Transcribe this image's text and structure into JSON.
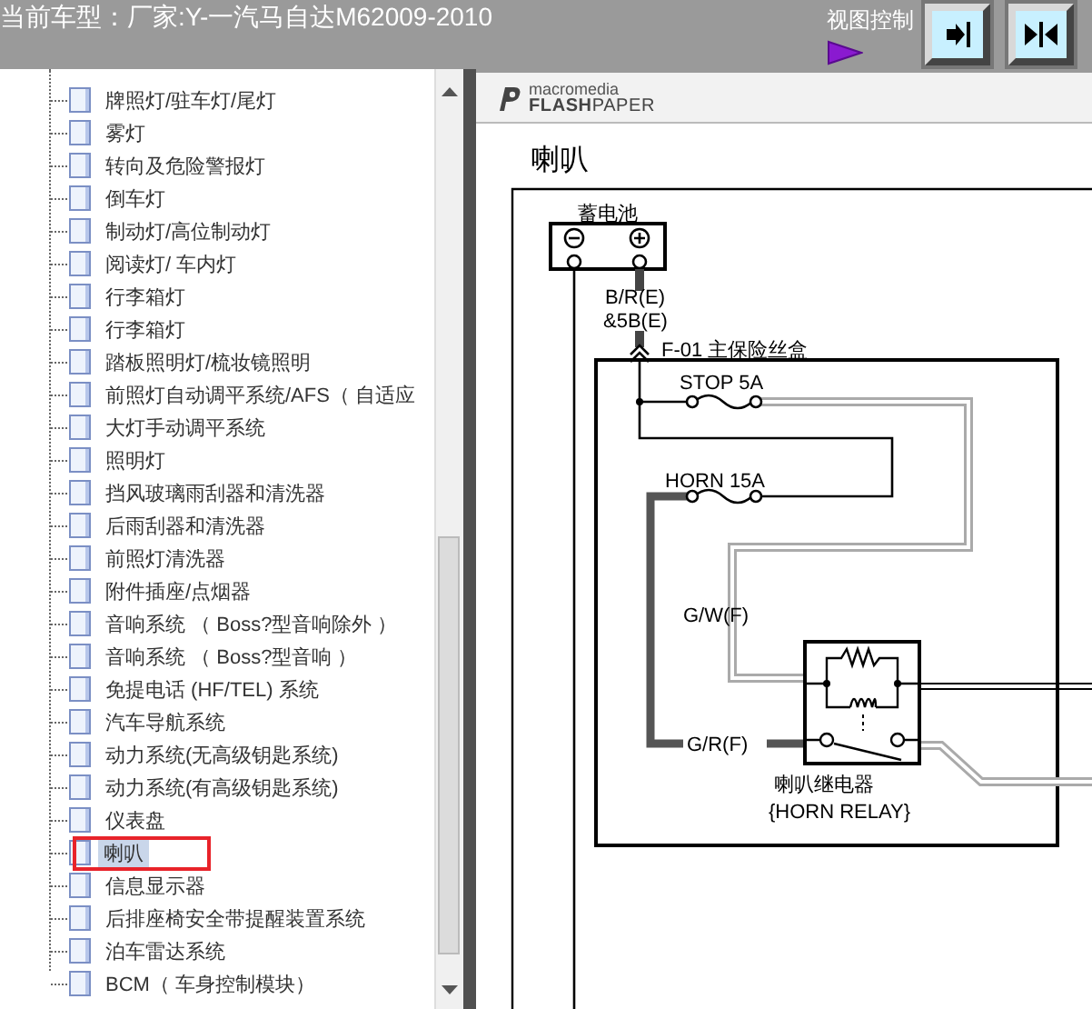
{
  "title_bar": {
    "text": "当前车型：厂家:Y-一汽马自达M62009-2010"
  },
  "view_control": {
    "label": "视图控制",
    "buttons": [
      {
        "kind": "expand"
      },
      {
        "kind": "split"
      }
    ]
  },
  "tree": {
    "items": [
      {
        "label": "牌照灯/驻车灯/尾灯",
        "selected": false
      },
      {
        "label": "雾灯",
        "selected": false
      },
      {
        "label": "转向及危险警报灯",
        "selected": false
      },
      {
        "label": "倒车灯",
        "selected": false
      },
      {
        "label": "制动灯/高位制动灯",
        "selected": false
      },
      {
        "label": "阅读灯/ 车内灯",
        "selected": false
      },
      {
        "label": "行李箱灯",
        "selected": false
      },
      {
        "label": "行李箱灯",
        "selected": false
      },
      {
        "label": "踏板照明灯/梳妆镜照明",
        "selected": false
      },
      {
        "label": "前照灯自动调平系统/AFS（ 自适应",
        "selected": false
      },
      {
        "label": "大灯手动调平系统",
        "selected": false
      },
      {
        "label": "照明灯",
        "selected": false
      },
      {
        "label": "挡风玻璃雨刮器和清洗器",
        "selected": false
      },
      {
        "label": "后雨刮器和清洗器",
        "selected": false
      },
      {
        "label": "前照灯清洗器",
        "selected": false
      },
      {
        "label": "附件插座/点烟器",
        "selected": false
      },
      {
        "label": "音响系统 （ Boss?型音响除外 ）",
        "selected": false
      },
      {
        "label": "音响系统 （ Boss?型音响 ）",
        "selected": false
      },
      {
        "label": "免提电话 (HF/TEL) 系统",
        "selected": false
      },
      {
        "label": "汽车导航系统",
        "selected": false
      },
      {
        "label": "动力系统(无高级钥匙系统)",
        "selected": false
      },
      {
        "label": "动力系统(有高级钥匙系统)",
        "selected": false
      },
      {
        "label": "仪表盘",
        "selected": false
      },
      {
        "label": "喇叭",
        "selected": true
      },
      {
        "label": "信息显示器",
        "selected": false
      },
      {
        "label": "后排座椅安全带提醒装置系统",
        "selected": false
      },
      {
        "label": "泊车雷达系统",
        "selected": false
      },
      {
        "label": "BCM（ 车身控制模块）",
        "selected": false
      }
    ]
  },
  "viewer": {
    "brand_small": "macromedia",
    "brand_large": "**FLASH**PAPER",
    "page_title": "喇叭",
    "diagram": {
      "labels": [
        "蓄电池",
        "B/R(E)",
        "&5B(E)",
        "F-01  主保险丝盒",
        "STOP 5A",
        "HORN 15A",
        "G/W(F)",
        "G/R(F)",
        "喇叭继电器",
        "{HORN RELAY}"
      ]
    }
  }
}
